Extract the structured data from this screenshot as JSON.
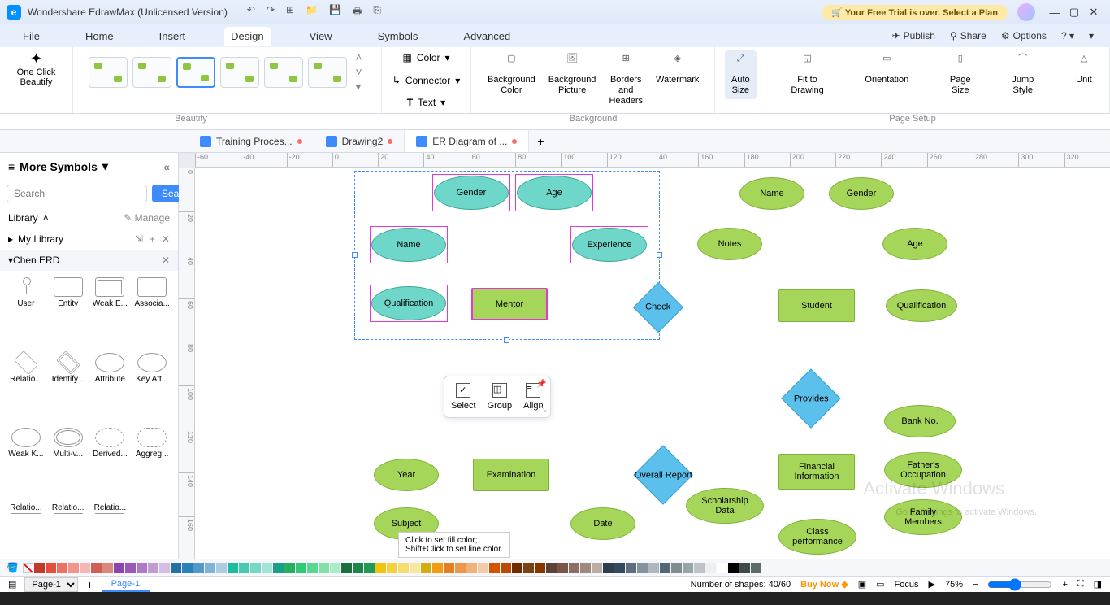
{
  "app": {
    "title": "Wondershare EdrawMax (Unlicensed Version)"
  },
  "trial": "Your Free Trial is over. Select a Plan",
  "menu": {
    "items": [
      "File",
      "Home",
      "Insert",
      "Design",
      "View",
      "Symbols",
      "Advanced"
    ],
    "active": "Design",
    "right": {
      "publish": "Publish",
      "share": "Share",
      "options": "Options"
    }
  },
  "ribbon": {
    "beautify": {
      "big": "One Click\nBeautify",
      "label": "Beautify"
    },
    "textgroup": {
      "color": "Color",
      "connector": "Connector",
      "text": "Text"
    },
    "background": {
      "bgcolor": "Background\nColor",
      "bgpic": "Background\nPicture",
      "borders": "Borders and\nHeaders",
      "watermark": "Watermark",
      "label": "Background"
    },
    "pagesetup": {
      "autosize": "Auto\nSize",
      "fit": "Fit to\nDrawing",
      "orientation": "Orientation",
      "pagesize": "Page\nSize",
      "jumpstyle": "Jump\nStyle",
      "unit": "Unit",
      "label": "Page Setup"
    }
  },
  "doctabs": [
    {
      "name": "Training Proces...",
      "dirty": true,
      "active": false
    },
    {
      "name": "Drawing2",
      "dirty": true,
      "active": false
    },
    {
      "name": "ER Diagram of ...",
      "dirty": true,
      "active": true
    }
  ],
  "sidepanel": {
    "header": "More Symbols",
    "search_placeholder": "Search",
    "search_btn": "Search",
    "library": "Library",
    "manage": "Manage",
    "mylibrary": "My Library",
    "section": "Chen ERD",
    "shapes": [
      "User",
      "Entity",
      "Weak E...",
      "Associa...",
      "Relatio...",
      "Identify...",
      "Attribute",
      "Key Att...",
      "Weak K...",
      "Multi-v...",
      "Derived...",
      "Aggreg...",
      "Relatio...",
      "Relatio...",
      "Relatio..."
    ]
  },
  "ruler_h": [
    "-60",
    "-40",
    "-20",
    "0",
    "20",
    "40",
    "60",
    "80",
    "100",
    "120",
    "140",
    "160",
    "180",
    "200",
    "220",
    "240",
    "260",
    "280",
    "300",
    "320"
  ],
  "ruler_v": [
    "0",
    "20",
    "40",
    "60",
    "80",
    "100",
    "120",
    "140",
    "160"
  ],
  "er": {
    "gender": "Gender",
    "age": "Age",
    "name": "Name",
    "experience": "Experience",
    "qualification": "Qualification",
    "mentor": "Mentor",
    "check": "Check",
    "student": "Student",
    "name2": "Name",
    "gender2": "Gender",
    "notes": "Notes",
    "age2": "Age",
    "qualification2": "Qualification",
    "provides": "Provides",
    "examination": "Examination",
    "year": "Year",
    "subject": "Subject",
    "date": "Date",
    "overallreport": "Overall Report",
    "financial": "Financial\nInformation",
    "bankno": "Bank No.",
    "fathers": "Father's\nOccupation",
    "family": "Family\nMembers",
    "scholarship": "Scholarship\nData",
    "classperf": "Class\nperformance"
  },
  "floattb": {
    "select": "Select",
    "group": "Group",
    "align": "Align"
  },
  "colortip": "Click to set fill color;\nShift+Click to set line color.",
  "statusbar": {
    "page_selector": "Page-1",
    "page_tab": "Page-1",
    "shapes": "Number of shapes: 40/60",
    "buy": "Buy Now",
    "focus": "Focus",
    "zoom": "75%"
  },
  "watermark": "Activate Windows",
  "watermark2": "Go to Settings to activate Windows.",
  "colors": [
    "#c0392b",
    "#e74c3c",
    "#ec7063",
    "#f1948a",
    "#f5b7b1",
    "#cd6155",
    "#d98880",
    "#8e44ad",
    "#9b59b6",
    "#af7ac5",
    "#c39bd3",
    "#d7bde2",
    "#2471a3",
    "#2980b9",
    "#5499c7",
    "#7fb3d5",
    "#a9cce3",
    "#1abc9c",
    "#48c9b0",
    "#76d7c4",
    "#a3e4d7",
    "#16a085",
    "#27ae60",
    "#2ecc71",
    "#58d68d",
    "#82e0aa",
    "#abebc6",
    "#196f3d",
    "#1e8449",
    "#229954",
    "#f1c40f",
    "#f4d03f",
    "#f7dc6f",
    "#f9e79f",
    "#d4ac0d",
    "#f39c12",
    "#e67e22",
    "#eb984e",
    "#f0b27a",
    "#f5cba7",
    "#d35400",
    "#ba4a00",
    "#6e2c00",
    "#784212",
    "#873600",
    "#5d4037",
    "#795548",
    "#8d6e63",
    "#a1887f",
    "#bcaaa4",
    "#2c3e50",
    "#34495e",
    "#5d6d7e",
    "#85929e",
    "#aeb6bf",
    "#566573",
    "#7f8c8d",
    "#95a5a6",
    "#bdc3c7",
    "#ecf0f1",
    "#ffffff",
    "#000000",
    "#424949",
    "#616a6b"
  ]
}
